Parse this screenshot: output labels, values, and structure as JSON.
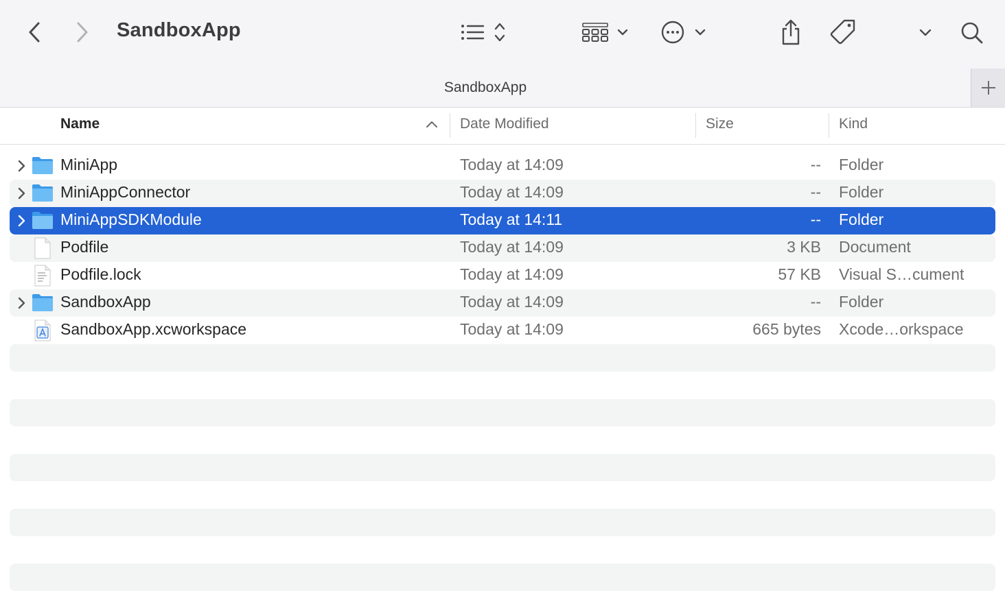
{
  "window": {
    "title": "SandboxApp"
  },
  "toolbar": {
    "back_icon": "chevron-left-icon",
    "forward_icon": "chevron-right-icon",
    "view_list_icon": "list-view-icon",
    "group_icon": "grid-group-icon",
    "action_icon": "ellipsis-circle-icon",
    "share_icon": "share-icon",
    "tag_icon": "tag-icon",
    "search_icon": "search-icon"
  },
  "tab": {
    "label": "SandboxApp"
  },
  "columns": {
    "name": "Name",
    "date_modified": "Date Modified",
    "size": "Size",
    "kind": "Kind"
  },
  "files": [
    {
      "name": "MiniApp",
      "date": "Today at 14:09",
      "size": "--",
      "kind": "Folder",
      "type": "folder"
    },
    {
      "name": "MiniAppConnector",
      "date": "Today at 14:09",
      "size": "--",
      "kind": "Folder",
      "type": "folder"
    },
    {
      "name": "MiniAppSDKModule",
      "date": "Today at 14:11",
      "size": "--",
      "kind": "Folder",
      "type": "folder",
      "selected": true
    },
    {
      "name": "Podfile",
      "date": "Today at 14:09",
      "size": "3 KB",
      "kind": "Document",
      "type": "document"
    },
    {
      "name": "Podfile.lock",
      "date": "Today at 14:09",
      "size": "57 KB",
      "kind": "Visual S…cument",
      "type": "text"
    },
    {
      "name": "SandboxApp",
      "date": "Today at 14:09",
      "size": "--",
      "kind": "Folder",
      "type": "folder"
    },
    {
      "name": "SandboxApp.xcworkspace",
      "date": "Today at 14:09",
      "size": "665 bytes",
      "kind": "Xcode…orkspace",
      "type": "workspace"
    }
  ],
  "colors": {
    "selection": "#2463d6",
    "folder": "#5fb0f0",
    "stripe": "#f3f4f4"
  }
}
